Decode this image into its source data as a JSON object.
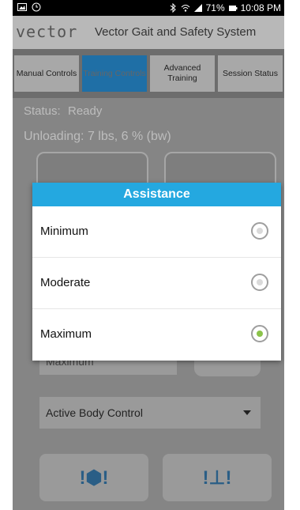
{
  "status_bar": {
    "battery": "71%",
    "time": "10:08 PM"
  },
  "app": {
    "logo": "vector",
    "title": "Vector Gait and Safety System"
  },
  "tabs": [
    {
      "label": "Manual Controls",
      "active": false
    },
    {
      "label": "Training Controls",
      "active": true
    },
    {
      "label": "Advanced Training",
      "active": false
    },
    {
      "label": "Session Status",
      "active": false
    }
  ],
  "content": {
    "status_label": "Status:",
    "status_value": "Ready",
    "unloading": "Unloading: 7 lbs, 6 % (bw)",
    "dropdown_partial": "Maximum",
    "active_body_control": "Active Body Control",
    "stop_button_symbol": "!⬢!",
    "lower_button_symbol": "!⊥!"
  },
  "dialog": {
    "title": "Assistance",
    "options": [
      {
        "label": "Minimum",
        "selected": false
      },
      {
        "label": "Moderate",
        "selected": false
      },
      {
        "label": "Maximum",
        "selected": true
      }
    ]
  },
  "colors": {
    "dialog_header": "#24a8e0",
    "radio_selected": "#8bc34a",
    "active_tab": "#1f6fa6"
  }
}
